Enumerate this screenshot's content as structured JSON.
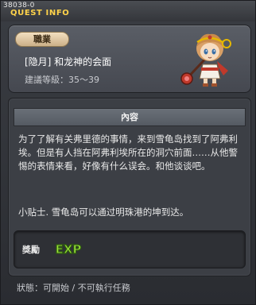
{
  "window": {
    "quest_id": "38038-0",
    "title": "QUEST INFO"
  },
  "info": {
    "job_label": "職業",
    "quest_name": "[隐月] 和龙神的会面",
    "level_req": "建議等級：35～39"
  },
  "content": {
    "header": "內容",
    "description": "为了了解有关弗里德的事情，来到雪龟岛找到了阿弗利埃。但是有人挡在阿弗利埃所在的洞穴前面……从他警惕的表情来看，好像有什么误会。和他谈谈吧。",
    "tip": "小贴士. 雪龟岛可以通过明珠港的坤到达。"
  },
  "reward": {
    "label": "獎勵",
    "exp_text": "EXP"
  },
  "status": {
    "text": "狀態：可開始 / 不可執行任務"
  },
  "colors": {
    "title_yellow": "#ffd34a",
    "exp_green": "#9be33a"
  },
  "icons": {
    "npc": "npc-portrait-icon",
    "exp": "exp-icon",
    "close": "close-icon"
  }
}
